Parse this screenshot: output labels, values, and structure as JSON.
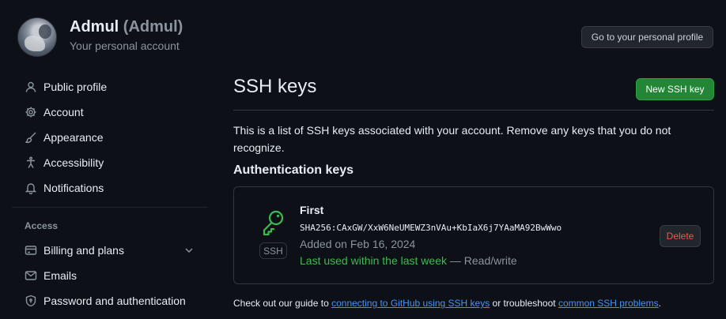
{
  "header": {
    "user_name": "Admul",
    "user_login": "(Admul)",
    "subtitle": "Your personal account",
    "profile_button": "Go to your personal profile"
  },
  "sidebar": {
    "items": [
      {
        "label": "Public profile",
        "icon": "person-icon"
      },
      {
        "label": "Account",
        "icon": "gear-icon"
      },
      {
        "label": "Appearance",
        "icon": "paintbrush-icon"
      },
      {
        "label": "Accessibility",
        "icon": "accessibility-icon"
      },
      {
        "label": "Notifications",
        "icon": "bell-icon"
      }
    ],
    "access_heading": "Access",
    "access_items": [
      {
        "label": "Billing and plans",
        "icon": "credit-card-icon"
      },
      {
        "label": "Emails",
        "icon": "mail-icon"
      },
      {
        "label": "Password and authentication",
        "icon": "shield-lock-icon"
      }
    ]
  },
  "main": {
    "title": "SSH keys",
    "new_button": "New SSH key",
    "description": "This is a list of SSH keys associated with your account. Remove any keys that you do not recognize.",
    "auth_heading": "Authentication keys",
    "key": {
      "title": "First",
      "fingerprint": "SHA256:CAxGW/XxW6NeUMEWZ3nVAu+KbIaX6j7YAaMA92BwWwo",
      "added": "Added on Feb 16, 2024",
      "last_used": "Last used within the last week",
      "access": "— Read/write",
      "badge": "SSH",
      "delete_button": "Delete"
    },
    "footer": {
      "prefix": "Check out our guide to",
      "link1": "connecting to GitHub using SSH keys",
      "middle": "or troubleshoot",
      "link2": "common SSH problems",
      "suffix": "."
    }
  },
  "colors": {
    "background": "#0d1117",
    "accent_green": "#238636",
    "link_blue": "#4493f8",
    "danger_red": "#f85149",
    "key_green": "#3fb950"
  }
}
